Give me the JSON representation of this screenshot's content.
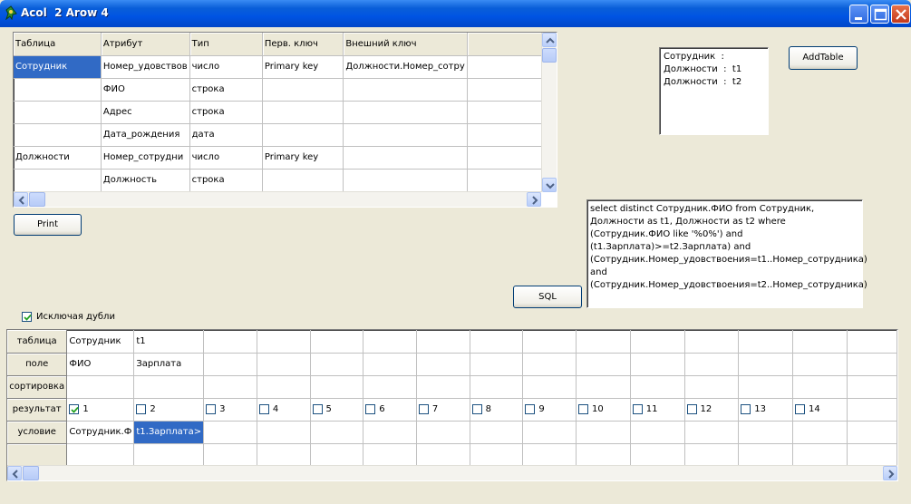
{
  "window": {
    "title": "Acol  2 Arow 4"
  },
  "schema_grid": {
    "headers": [
      "Таблица",
      "Атрибут",
      "Тип",
      "Перв. ключ",
      "Внешний ключ"
    ],
    "rows": [
      [
        "Сотрудник",
        "Номер_удовствов",
        "число",
        "Primary key",
        "Должности.Номер_сотру"
      ],
      [
        "",
        "ФИО",
        "строка",
        "",
        ""
      ],
      [
        "",
        "Адрес",
        "строка",
        "",
        ""
      ],
      [
        "",
        "Дата_рождения",
        "дата",
        "",
        ""
      ],
      [
        "Должности",
        "Номер_сотрудни",
        "число",
        "Primary key",
        ""
      ],
      [
        "",
        "Должность",
        "строка",
        "",
        ""
      ]
    ]
  },
  "buttons": {
    "print": "Print",
    "add_table": "AddTable",
    "sql": "SQL"
  },
  "tables_list": [
    "Сотрудник  :",
    "Должности  :  t1",
    "Должности  :  t2"
  ],
  "sql_text": "select distinct Сотрудник.ФИО from Сотрудник, Должности as t1, Должности as t2 where (Сотрудник.ФИО like '%0%') and (t1.Зарплата)>=t2.Зарплата) and (Сотрудник.Номер_удовствоения=t1..Номер_сотрудника) and (Сотрудник.Номер_удовствоения=t2..Номер_сотрудника)",
  "exclude_duplicates": {
    "label": "Исключая дубли",
    "checked": true
  },
  "query_grid": {
    "row_labels": [
      "таблица",
      "поле",
      "сортировка",
      "результат",
      "условие"
    ],
    "table_row": [
      "Сотрудник",
      "t1"
    ],
    "field_row": [
      "ФИО",
      "Зарплата"
    ],
    "result_cols": [
      "1",
      "2",
      "3",
      "4",
      "5",
      "6",
      "7",
      "8",
      "9",
      "10",
      "11",
      "12",
      "13",
      "14"
    ],
    "result_checked": [
      true,
      false,
      false,
      false,
      false,
      false,
      false,
      false,
      false,
      false,
      false,
      false,
      false,
      false
    ],
    "condition_row": [
      "Сотрудник.Ф",
      "t1.Зарплата>"
    ]
  }
}
